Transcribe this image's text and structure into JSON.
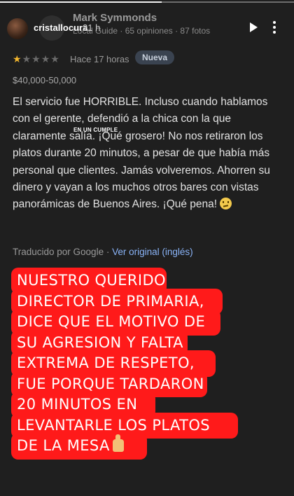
{
  "story": {
    "progress_fraction": 0.55,
    "username": "cristallocura",
    "time_ago": "21 h",
    "play_icon": "play-icon",
    "more_icon": "more-options-icon"
  },
  "review": {
    "reviewer_name": "Mark Symmonds",
    "reviewer_meta": "Local Guide · 65 opiniones · 87 fotos",
    "stars": "★★★★★",
    "rating": 1,
    "rating_max": 5,
    "time": "Hace 17 horas",
    "badge": "Nueva",
    "price": "$40,000-50,000",
    "body": "El servicio fue HORRIBLE. Incluso cuando hablamos con el gerente, defendió a la chica con la que claramente salía. ¡Qué grosero! No nos retiraron los platos durante 20 minutos, a pesar de que había más personal que clientes. Jamás volveremos. Ahorren su dinero y vayan a los muchos otros bares con vistas panorámicas de Buenos Aires. ¡Qué pena!",
    "overlay_note": "EN UN CUMPLE",
    "translated_by": "Traducido por Google · ",
    "view_original": "Ver original (inglés)"
  },
  "sticker": {
    "lines": [
      "NUESTRO QUERIDO",
      "DIRECTOR DE PRIMARIA,",
      "DICE QUE EL MOTIVO DE",
      "SU AGRESION Y FALTA",
      "EXTREMA DE RESPETO,",
      "FUE PORQUE TARDARON",
      "20 MINUTOS EN",
      "LEVANTARLE LOS PLATOS",
      "DE LA MESA"
    ],
    "end_icon": "thumbs-up-icon"
  },
  "colors": {
    "background": "#1f1f1f",
    "star": "#f5b82e",
    "link": "#8ab4f8",
    "sticker_bg": "#ff1a1a"
  }
}
